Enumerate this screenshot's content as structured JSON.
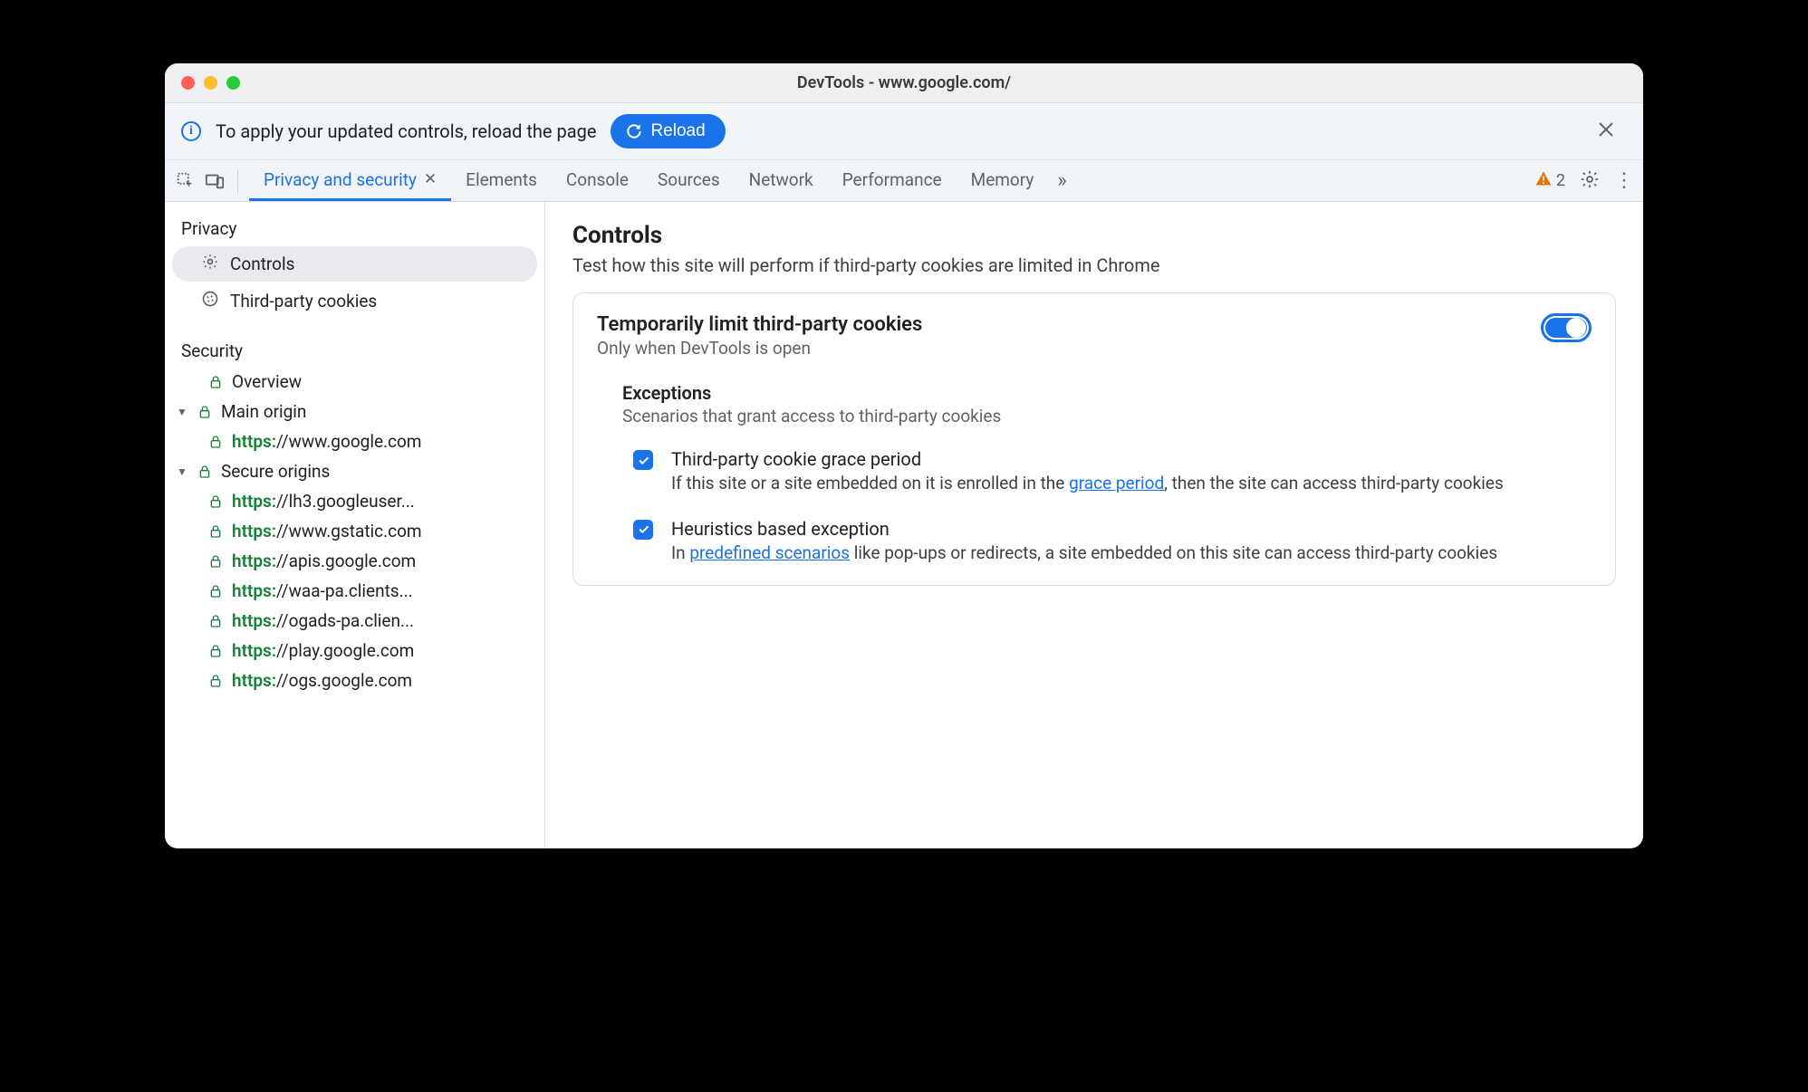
{
  "window": {
    "title": "DevTools - www.google.com/"
  },
  "infobar": {
    "text": "To apply your updated controls, reload the page",
    "reload_label": "Reload"
  },
  "toolbar": {
    "tabs": [
      {
        "label": "Privacy and security",
        "active": true,
        "closable": true
      },
      {
        "label": "Elements"
      },
      {
        "label": "Console"
      },
      {
        "label": "Sources"
      },
      {
        "label": "Network"
      },
      {
        "label": "Performance"
      },
      {
        "label": "Memory"
      }
    ],
    "warnings_count": "2"
  },
  "sidebar": {
    "privacy_label": "Privacy",
    "items": [
      {
        "label": "Controls",
        "icon": "gear",
        "selected": true
      },
      {
        "label": "Third-party cookies",
        "icon": "cookie"
      }
    ],
    "security_label": "Security",
    "overview_label": "Overview",
    "main_origin_label": "Main origin",
    "main_origin_url": {
      "scheme": "https:",
      "rest": "//www.google.com"
    },
    "secure_origins_label": "Secure origins",
    "secure_origins": [
      {
        "scheme": "https:",
        "rest": "//lh3.googleuser..."
      },
      {
        "scheme": "https:",
        "rest": "//www.gstatic.com"
      },
      {
        "scheme": "https:",
        "rest": "//apis.google.com"
      },
      {
        "scheme": "https:",
        "rest": "//waa-pa.clients..."
      },
      {
        "scheme": "https:",
        "rest": "//ogads-pa.clien..."
      },
      {
        "scheme": "https:",
        "rest": "//play.google.com"
      },
      {
        "scheme": "https:",
        "rest": "//ogs.google.com"
      }
    ]
  },
  "main": {
    "title": "Controls",
    "subtitle": "Test how this site will perform if third-party cookies are limited in Chrome",
    "card": {
      "title": "Temporarily limit third-party cookies",
      "sub": "Only when DevTools is open",
      "exceptions_title": "Exceptions",
      "exceptions_sub": "Scenarios that grant access to third-party cookies",
      "items": [
        {
          "title": "Third-party cookie grace period",
          "pre": "If this site or a site embedded on it is enrolled in the ",
          "link": "grace period",
          "post": ", then the site can access third-party cookies"
        },
        {
          "title": "Heuristics based exception",
          "pre": "In ",
          "link": "predefined scenarios",
          "post": " like pop-ups or redirects, a site embedded on this site can access third-party cookies"
        }
      ]
    }
  }
}
